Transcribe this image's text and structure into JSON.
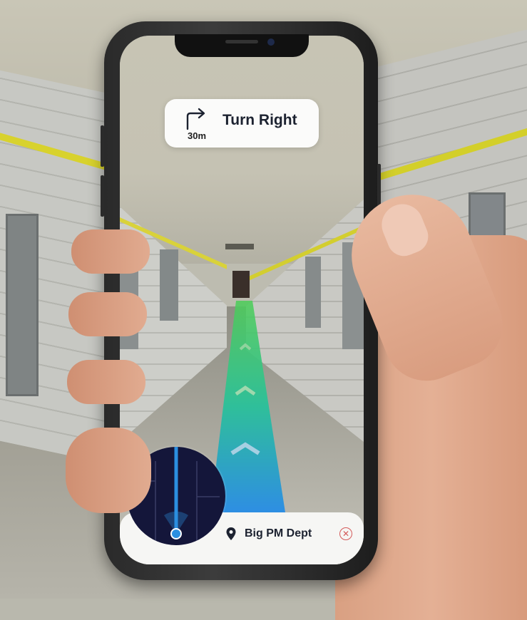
{
  "navigation": {
    "instruction": "Turn Right",
    "distance": "30m",
    "turn_icon": "turn-right-arrow-icon"
  },
  "destination": {
    "name": "Big PM Dept",
    "pin_icon": "location-pin-icon",
    "close_icon": "close-circle-icon",
    "close_symbol": "✕"
  },
  "minimap": {
    "user_marker": "user-location-dot",
    "background_color": "#14163a",
    "route_color": "#2b8fe0"
  },
  "ar_path": {
    "gradient_top": "#4ccd57",
    "gradient_bottom": "#2e8ee3",
    "chevron_count": 3
  }
}
